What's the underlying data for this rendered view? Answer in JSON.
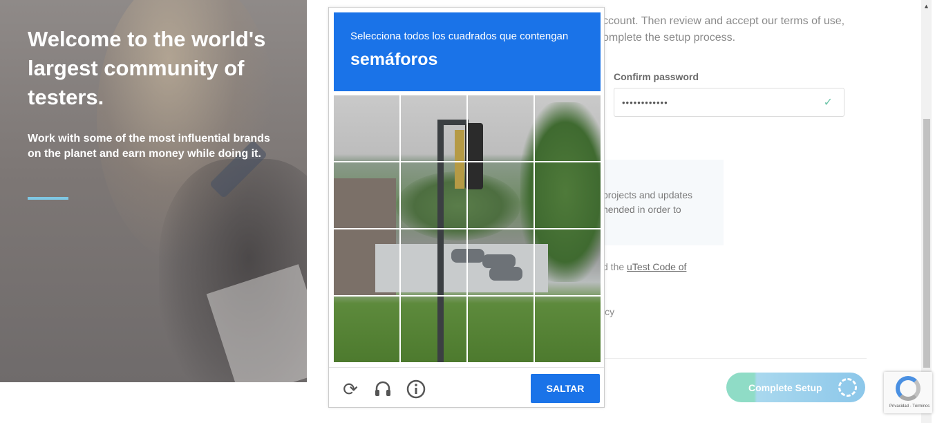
{
  "hero": {
    "title": "Welcome to the world's largest community of testers.",
    "subtitle": "Work with some of the most influential brands on the planet and earn money while doing it."
  },
  "form": {
    "intro_text": "ccount. Then review and accept our terms of use, omplete the setup process.",
    "confirm_password_label": "Confirm password",
    "confirm_password_value": "••••••••••••",
    "info_text": "projects and updates nended in order to",
    "code_prefix": "d the",
    "code_link": "uTest Code of",
    "icy_text": "icy",
    "complete_button": "Complete Setup"
  },
  "captcha": {
    "instruction": "Selecciona todos los cuadrados que contengan",
    "target": "semáforos",
    "skip_button": "SALTAR",
    "icons": [
      "reload-icon",
      "audio-icon",
      "info-icon"
    ]
  },
  "badge": {
    "text": "Privacidad - Términos"
  },
  "colors": {
    "captcha_blue": "#1a73e8",
    "accent_cyan": "#7fc7e3",
    "check_green": "#6cc4a8"
  }
}
